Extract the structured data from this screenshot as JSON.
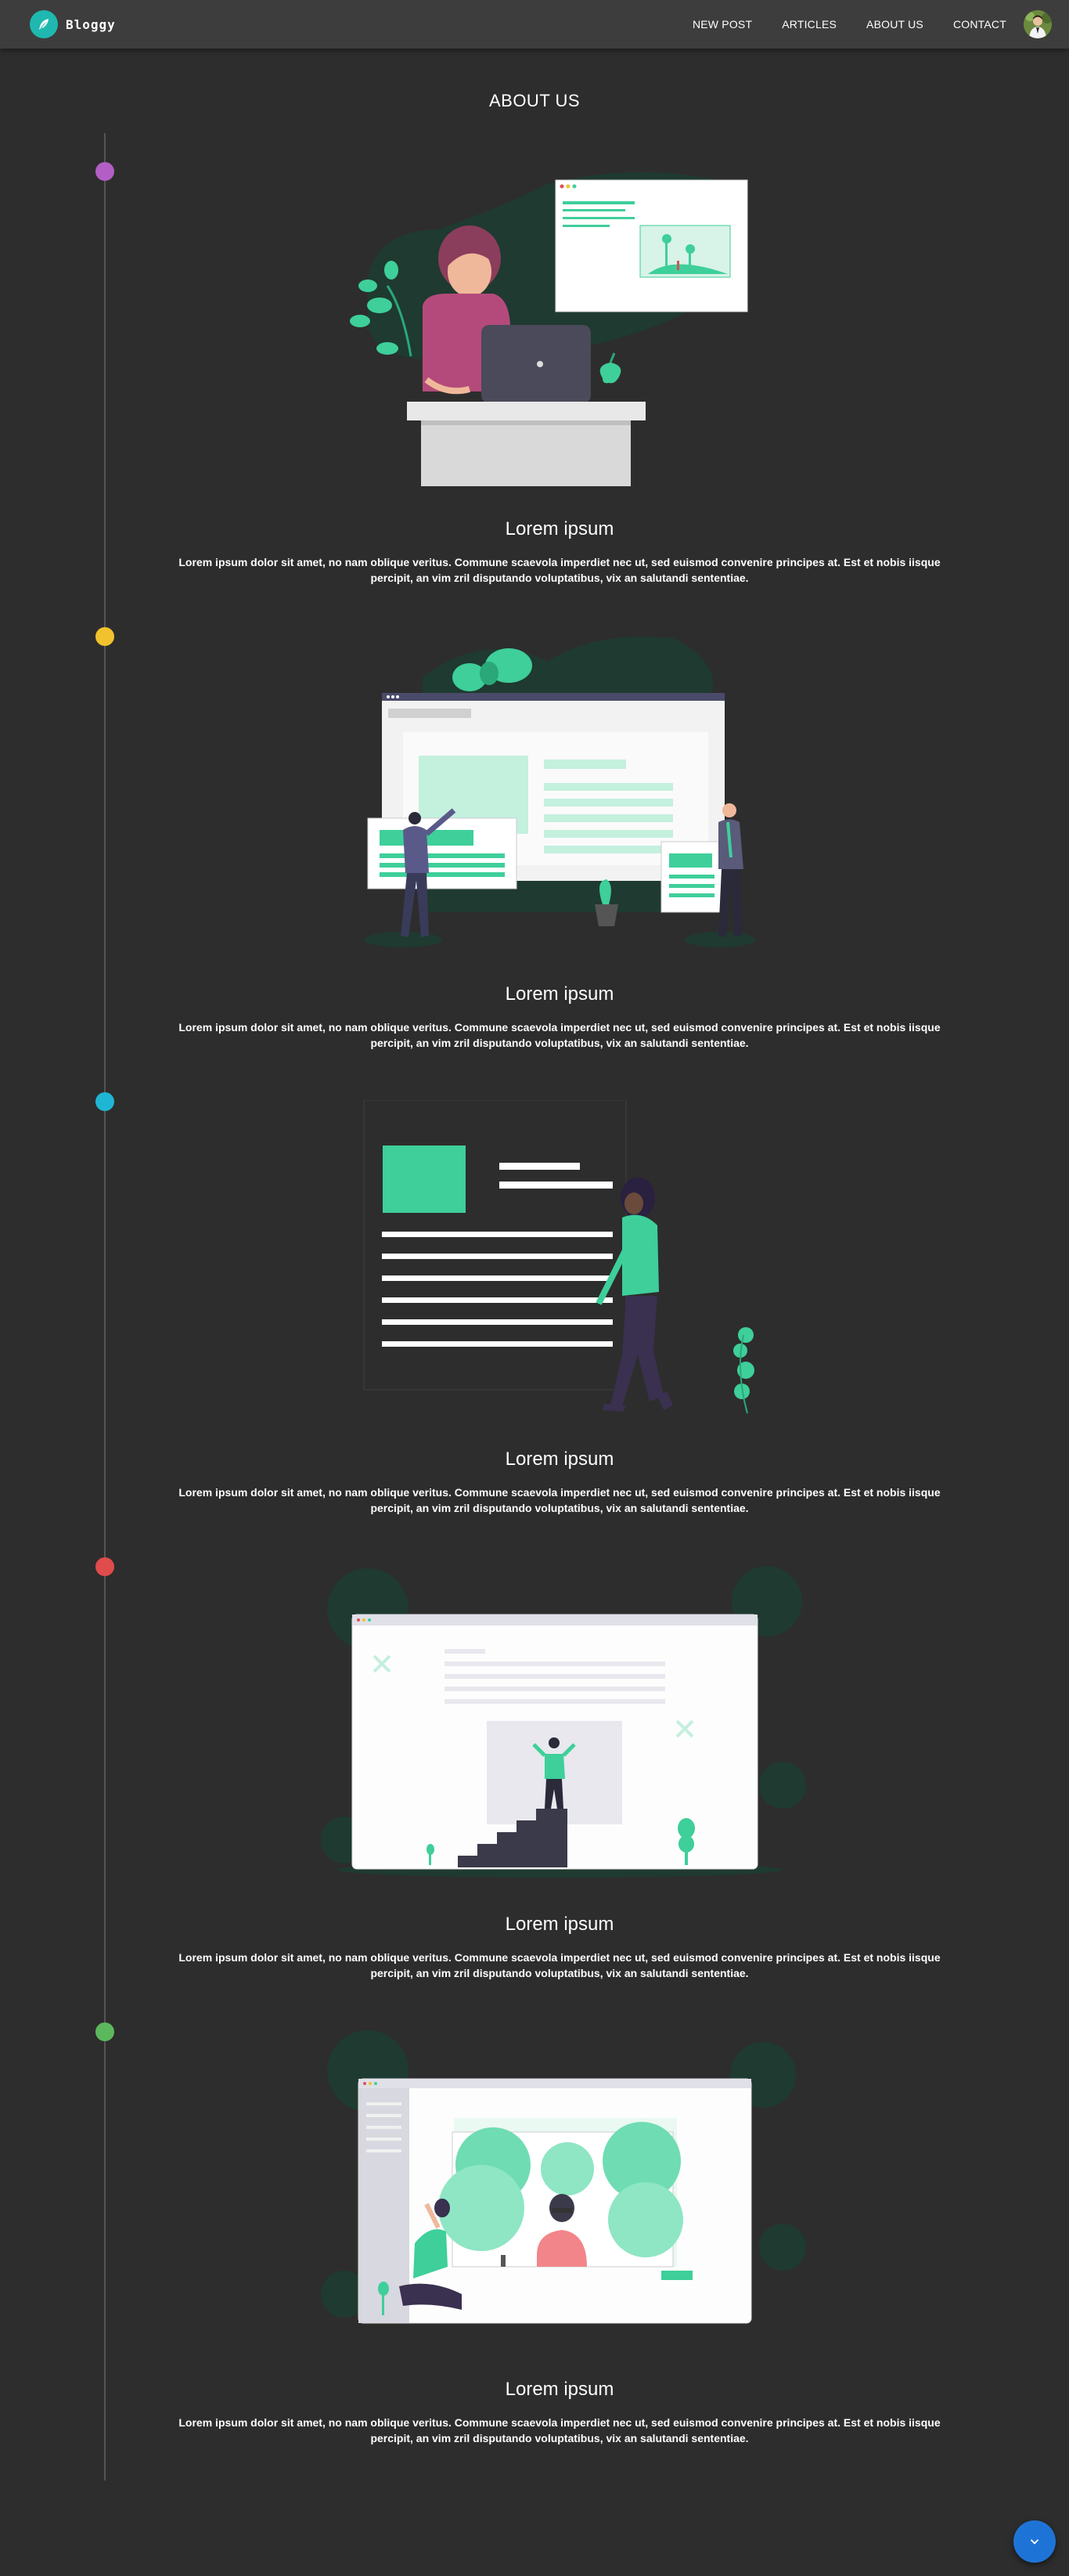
{
  "app": {
    "brand_name": "Bloggy"
  },
  "nav": {
    "links": [
      {
        "label": "NEW POST"
      },
      {
        "label": "ARTICLES"
      },
      {
        "label": "ABOUT US"
      },
      {
        "label": "CONTACT"
      }
    ]
  },
  "page": {
    "title": "ABOUT US"
  },
  "timeline": {
    "dot_colors": [
      "#b35ec4",
      "#f2c22e",
      "#1fb6d4",
      "#e04b4b",
      "#5cb85c"
    ],
    "sections": [
      {
        "title": "Lorem ipsum",
        "text": "Lorem ipsum dolor sit amet, no nam oblique veritus. Commune scaevola imperdiet nec ut, sed euismod convenire principes at. Est et nobis iisque percipit, an vim zril disputando voluptatibus, vix an salutandi sententiae."
      },
      {
        "title": "Lorem ipsum",
        "text": "Lorem ipsum dolor sit amet, no nam oblique veritus. Commune scaevola imperdiet nec ut, sed euismod convenire principes at. Est et nobis iisque percipit, an vim zril disputando voluptatibus, vix an salutandi sententiae."
      },
      {
        "title": "Lorem ipsum",
        "text": "Lorem ipsum dolor sit amet, no nam oblique veritus. Commune scaevola imperdiet nec ut, sed euismod convenire principes at. Est et nobis iisque percipit, an vim zril disputando voluptatibus, vix an salutandi sententiae."
      },
      {
        "title": "Lorem ipsum",
        "text": "Lorem ipsum dolor sit amet, no nam oblique veritus. Commune scaevola imperdiet nec ut, sed euismod convenire principes at. Est et nobis iisque percipit, an vim zril disputando voluptatibus, vix an salutandi sententiae."
      },
      {
        "title": "Lorem ipsum",
        "text": "Lorem ipsum dolor sit amet, no nam oblique veritus. Commune scaevola imperdiet nec ut, sed euismod convenire principes at. Est et nobis iisque percipit, an vim zril disputando voluptatibus, vix an salutandi sententiae."
      }
    ]
  },
  "icons": {
    "brand": "feather-icon",
    "scroll_button": "chevron-down-icon"
  },
  "colors": {
    "background": "#2d2d2d",
    "navbar": "#3d3d3d",
    "accent_green": "#3ecf9a",
    "fab_blue": "#1e74d6",
    "brand_teal": "#1fb8b0"
  }
}
